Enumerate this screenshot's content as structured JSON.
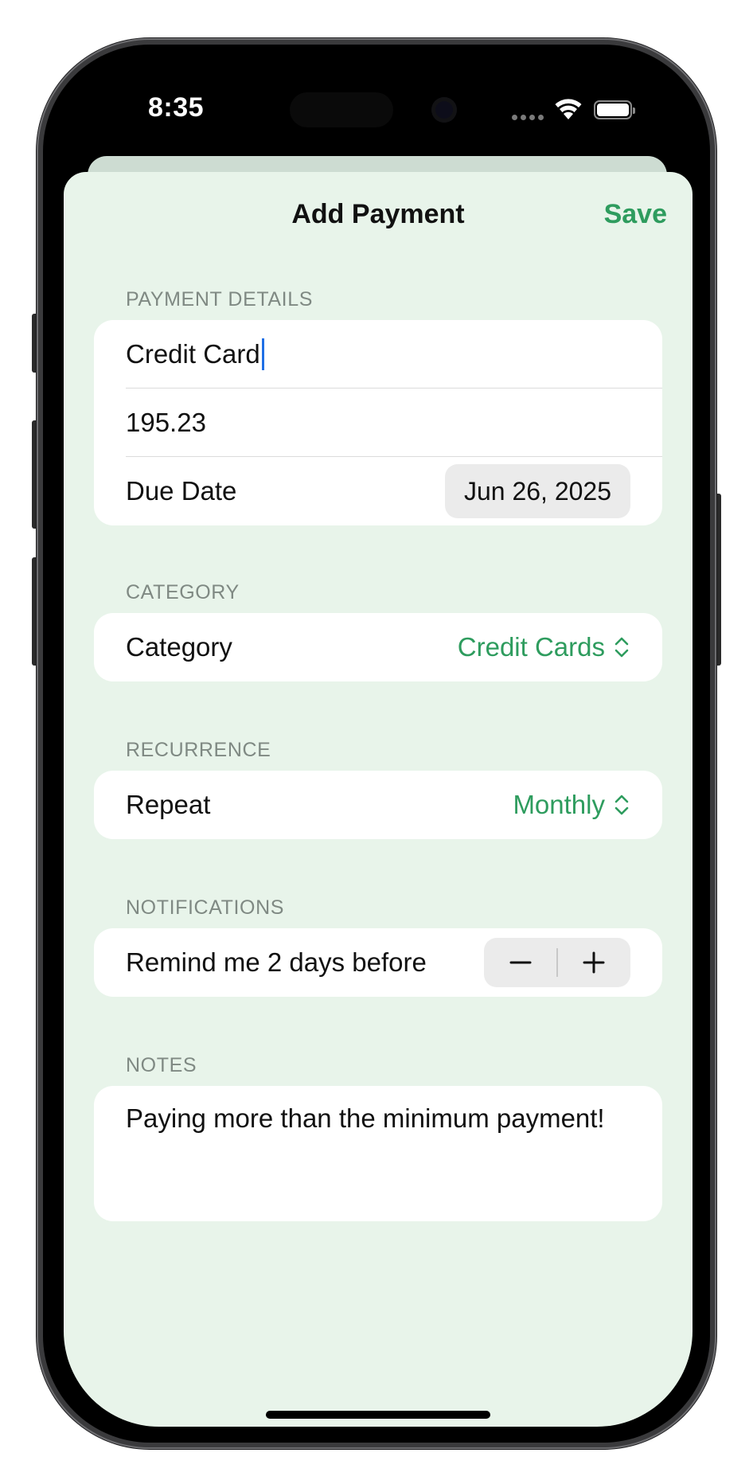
{
  "status_bar": {
    "time": "8:35",
    "icons": [
      "cellular-icon",
      "wifi-icon",
      "battery-icon"
    ]
  },
  "nav": {
    "title": "Add Payment",
    "save_label": "Save"
  },
  "payment_details": {
    "header": "PAYMENT DETAILS",
    "name_value": "Credit Card",
    "amount_value": "195.23",
    "due_date_label": "Due Date",
    "due_date_value": "Jun 26, 2025"
  },
  "category": {
    "header": "CATEGORY",
    "label": "Category",
    "value": "Credit Cards"
  },
  "recurrence": {
    "header": "RECURRENCE",
    "label": "Repeat",
    "value": "Monthly"
  },
  "notifications": {
    "header": "NOTIFICATIONS",
    "label": "Remind me 2 days before",
    "decrement_icon": "minus-icon",
    "increment_icon": "plus-icon"
  },
  "notes": {
    "header": "NOTES",
    "text": "Paying more than the minimum payment!"
  },
  "colors": {
    "accent": "#2e9c5e",
    "background": "#e8f4ea",
    "card": "#ffffff",
    "caret": "#1f6fe5"
  }
}
